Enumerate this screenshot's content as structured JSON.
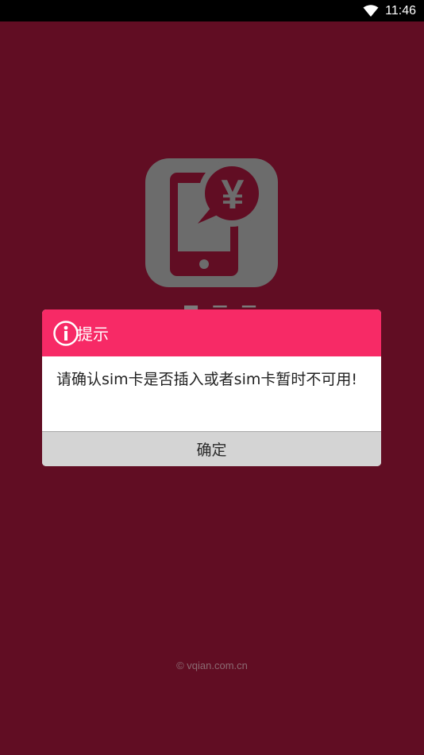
{
  "status_bar": {
    "time": "11:46",
    "icons": [
      "wifi-icon"
    ]
  },
  "splash": {
    "logo_icon": "phone-yuan-icon",
    "logo_symbol": "¥",
    "copyright": "© vqian.com.cn"
  },
  "dialog": {
    "icon": "info-icon",
    "title": "提示",
    "message": "请确认sim卡是否插入或者sim卡暂时不可用!",
    "confirm_label": "确定"
  },
  "colors": {
    "background": "#610d23",
    "dialog_header": "#f72a66",
    "button": "#d4d4d4"
  }
}
